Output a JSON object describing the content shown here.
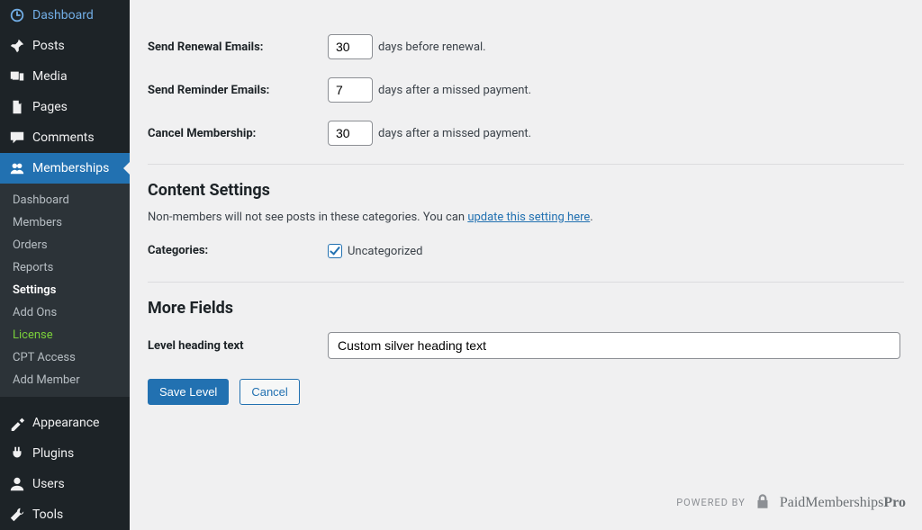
{
  "sidebar": {
    "main": [
      {
        "key": "dashboard",
        "label": "Dashboard"
      },
      {
        "key": "posts",
        "label": "Posts"
      },
      {
        "key": "media",
        "label": "Media"
      },
      {
        "key": "pages",
        "label": "Pages"
      },
      {
        "key": "comments",
        "label": "Comments"
      },
      {
        "key": "memberships",
        "label": "Memberships"
      }
    ],
    "submenu": [
      {
        "key": "dashboard",
        "label": "Dashboard"
      },
      {
        "key": "members",
        "label": "Members"
      },
      {
        "key": "orders",
        "label": "Orders"
      },
      {
        "key": "reports",
        "label": "Reports"
      },
      {
        "key": "settings",
        "label": "Settings"
      },
      {
        "key": "addons",
        "label": "Add Ons"
      },
      {
        "key": "license",
        "label": "License"
      },
      {
        "key": "cptaccess",
        "label": "CPT Access"
      },
      {
        "key": "addmember",
        "label": "Add Member"
      }
    ],
    "bottom": [
      {
        "key": "appearance",
        "label": "Appearance"
      },
      {
        "key": "plugins",
        "label": "Plugins"
      },
      {
        "key": "users",
        "label": "Users"
      },
      {
        "key": "tools",
        "label": "Tools"
      }
    ]
  },
  "form": {
    "renewal": {
      "label": "Send Renewal Emails:",
      "value": "30",
      "suffix": "days before renewal."
    },
    "reminder": {
      "label": "Send Reminder Emails:",
      "value": "7",
      "suffix": "days after a missed payment."
    },
    "cancel": {
      "label": "Cancel Membership:",
      "value": "30",
      "suffix": "days after a missed payment."
    }
  },
  "content_settings": {
    "title": "Content Settings",
    "desc_prefix": "Non-members will not see posts in these categories. You can ",
    "desc_link": "update this setting here",
    "desc_suffix": ".",
    "categories_label": "Categories:",
    "category_name": "Uncategorized",
    "category_checked": true
  },
  "more_fields": {
    "title": "More Fields",
    "heading_label": "Level heading text",
    "heading_value": "Custom silver heading text"
  },
  "buttons": {
    "save": "Save Level",
    "cancel": "Cancel"
  },
  "powered": {
    "prefix": "POWERED BY",
    "brand_light": "PaidMemberships",
    "brand_bold": "Pro"
  }
}
